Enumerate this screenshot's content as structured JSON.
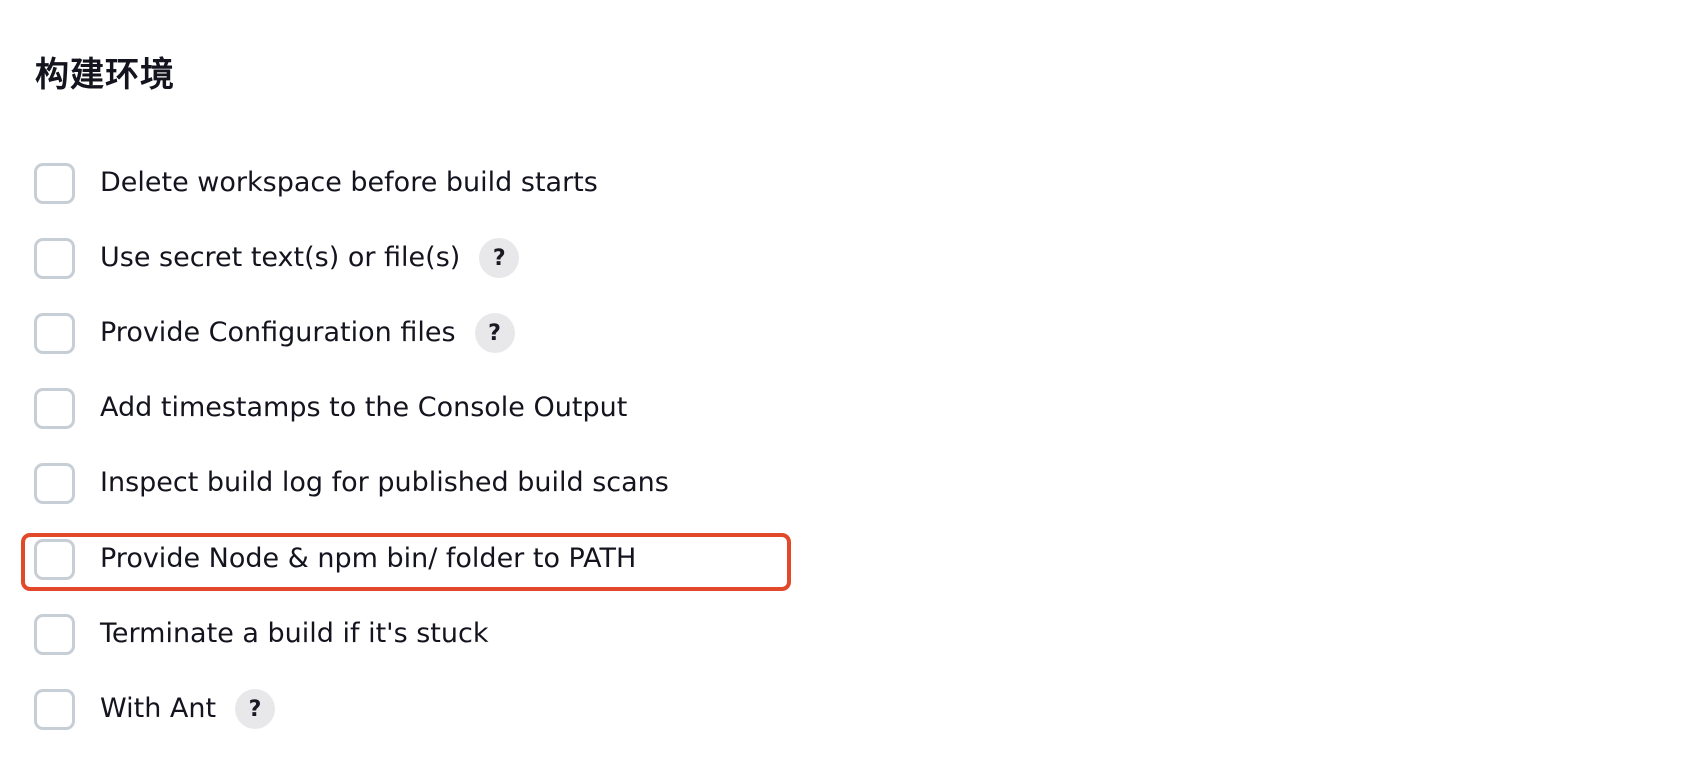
{
  "section": {
    "title": "构建环境"
  },
  "options": [
    {
      "label": "Delete workspace before build starts",
      "checked": false,
      "help": false
    },
    {
      "label": "Use secret text(s) or file(s)",
      "checked": false,
      "help": true
    },
    {
      "label": "Provide Configuration files",
      "checked": false,
      "help": true
    },
    {
      "label": "Add timestamps to the Console Output",
      "checked": false,
      "help": false
    },
    {
      "label": "Inspect build log for published build scans",
      "checked": false,
      "help": false
    },
    {
      "label": "Provide Node & npm bin/ folder to PATH",
      "checked": false,
      "help": false
    },
    {
      "label": "Terminate a build if it's stuck",
      "checked": false,
      "help": false
    },
    {
      "label": "With Ant",
      "checked": false,
      "help": true
    }
  ],
  "help_glyph": "?",
  "highlight": {
    "target": "Provide Node & npm bin/ folder to PATH",
    "color": "#e2492a"
  }
}
